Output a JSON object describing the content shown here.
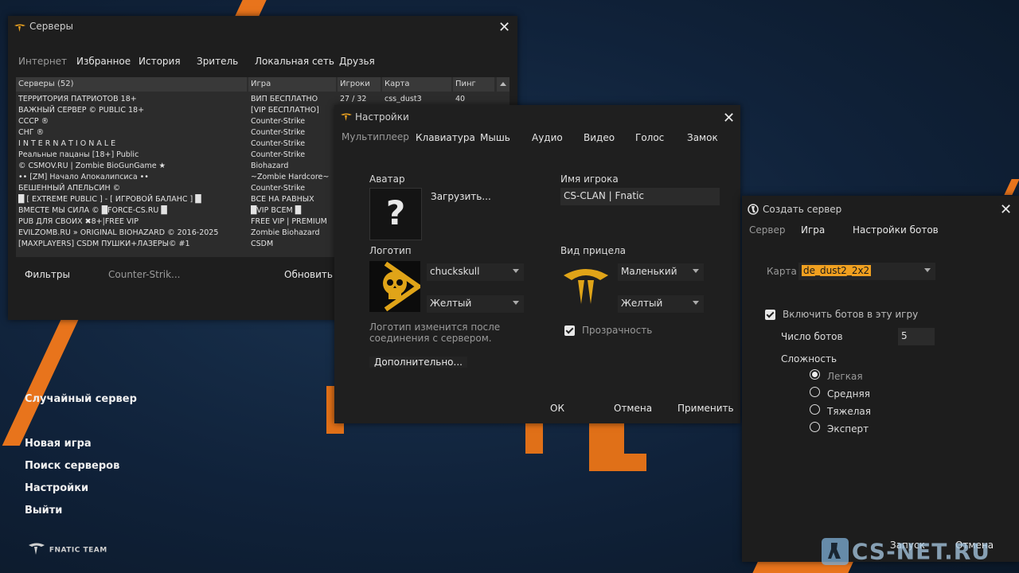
{
  "colors": {
    "accent": "#e8741c",
    "highlight": "#f0a020"
  },
  "servers_window": {
    "title": "Серверы",
    "tabs": [
      "Интернет",
      "Избранное",
      "История",
      "Зритель",
      "Локальная сеть",
      "Друзья"
    ],
    "columns": [
      "Серверы (52)",
      "Игра",
      "Игроки",
      "Карта",
      "Пинг"
    ],
    "rows": [
      {
        "name": "ТЕРРИТОРИЯ ПАТРИОТОВ 18+",
        "game": "ВИП БЕСПЛАТНО",
        "players": "27 / 32",
        "map": "css_dust3",
        "ping": "40"
      },
      {
        "name": "ВАЖНЫЙ СЕРВЕР © PUBLIC 18+",
        "game": "[VIP БЕСПЛАТНО]",
        "players": "",
        "map": "",
        "ping": ""
      },
      {
        "name": "СССР ®",
        "game": "Counter-Strike",
        "players": "",
        "map": "",
        "ping": ""
      },
      {
        "name": "СНГ ®",
        "game": "Counter-Strike",
        "players": "",
        "map": "",
        "ping": ""
      },
      {
        "name": "I N T E R N A T I O N A L E",
        "game": "Counter-Strike",
        "players": "",
        "map": "",
        "ping": ""
      },
      {
        "name": "Реальные пацаны [18+] Public",
        "game": "Counter-Strike",
        "players": "",
        "map": "",
        "ping": ""
      },
      {
        "name": "© CSMOV.RU | Zombie BioGunGame ★",
        "game": "Biohazard",
        "players": "",
        "map": "",
        "ping": ""
      },
      {
        "name": "•• [ZM] Начало Апокалипсиса ••",
        "game": "~Zombie Hardcore~",
        "players": "",
        "map": "",
        "ping": ""
      },
      {
        "name": "БЕШЕННЫЙ АПЕЛЬСИН ©",
        "game": "Counter-Strike",
        "players": "",
        "map": "",
        "ping": ""
      },
      {
        "name": "█ [ EXTREME PUBLIC ] - [ ИГРОВОЙ БАЛАНС ] █",
        "game": "ВСЕ НА РАВНЫХ",
        "players": "",
        "map": "",
        "ping": ""
      },
      {
        "name": "ВМЕСТЕ МЫ СИЛА © █FORCE-CS.RU █",
        "game": "█VIP ВСЕМ █",
        "players": "",
        "map": "",
        "ping": ""
      },
      {
        "name": "PUB ДЛЯ СВОИХ ✖8+|FREE VIP",
        "game": "FREE VIP | PREMIUM",
        "players": "",
        "map": "",
        "ping": ""
      },
      {
        "name": "EVILZOMB.RU » ORIGINAL BIOHAZARD © 2016-2025",
        "game": "Zombie Biohazard",
        "players": "",
        "map": "",
        "ping": ""
      },
      {
        "name": "[MAXPLAYERS] CSDM ПУШКИ+ЛАЗЕРЫ© #1",
        "game": "CSDM",
        "players": "",
        "map": "",
        "ping": ""
      }
    ],
    "filters_label": "Фильтры",
    "filter_value": "Counter-Strik...",
    "refresh_label": "Обновить"
  },
  "main_menu": {
    "random_server": "Случайный сервер",
    "items": [
      "Новая игра",
      "Поиск серверов",
      "Настройки",
      "Выйти"
    ],
    "team_logo": "FNATIC TEAM"
  },
  "settings_window": {
    "title": "Настройки",
    "tabs": [
      "Мультиплеер",
      "Клавиатура",
      "Мышь",
      "Аудио",
      "Видео",
      "Голос",
      "Замок"
    ],
    "avatar_label": "Аватар",
    "avatar_placeholder": "?",
    "upload_button": "Загрузить...",
    "player_name_label": "Имя игрока",
    "player_name_value": "CS-CLAN | Fnatic",
    "logo_label": "Логотип",
    "logo_select": "chuckskull",
    "logo_color": "Желтый",
    "logo_note": "Логотип изменится после соединения с сервером.",
    "crosshair_label": "Вид прицела",
    "crosshair_size": "Маленький",
    "crosshair_color": "Желтый",
    "transparency_label": "Прозрачность",
    "advanced_button": "Дополнительно...",
    "ok_button": "ОК",
    "cancel_button": "Отмена",
    "apply_button": "Применить"
  },
  "create_server_window": {
    "title": "Создать сервер",
    "tabs": [
      "Сервер",
      "Игра",
      "Настройки ботов"
    ],
    "map_label": "Карта",
    "map_value": "de_dust2_2x2",
    "enable_bots_label": "Включить ботов в эту игру",
    "bot_count_label": "Число ботов",
    "bot_count_value": "5",
    "difficulty_label": "Сложность",
    "difficulties": [
      "Легкая",
      "Средняя",
      "Тяжелая",
      "Эксперт"
    ],
    "selected_difficulty": "Легкая",
    "start_button": "Запуск",
    "cancel_button": "Отмена"
  },
  "watermark": "CS-NET.RU"
}
